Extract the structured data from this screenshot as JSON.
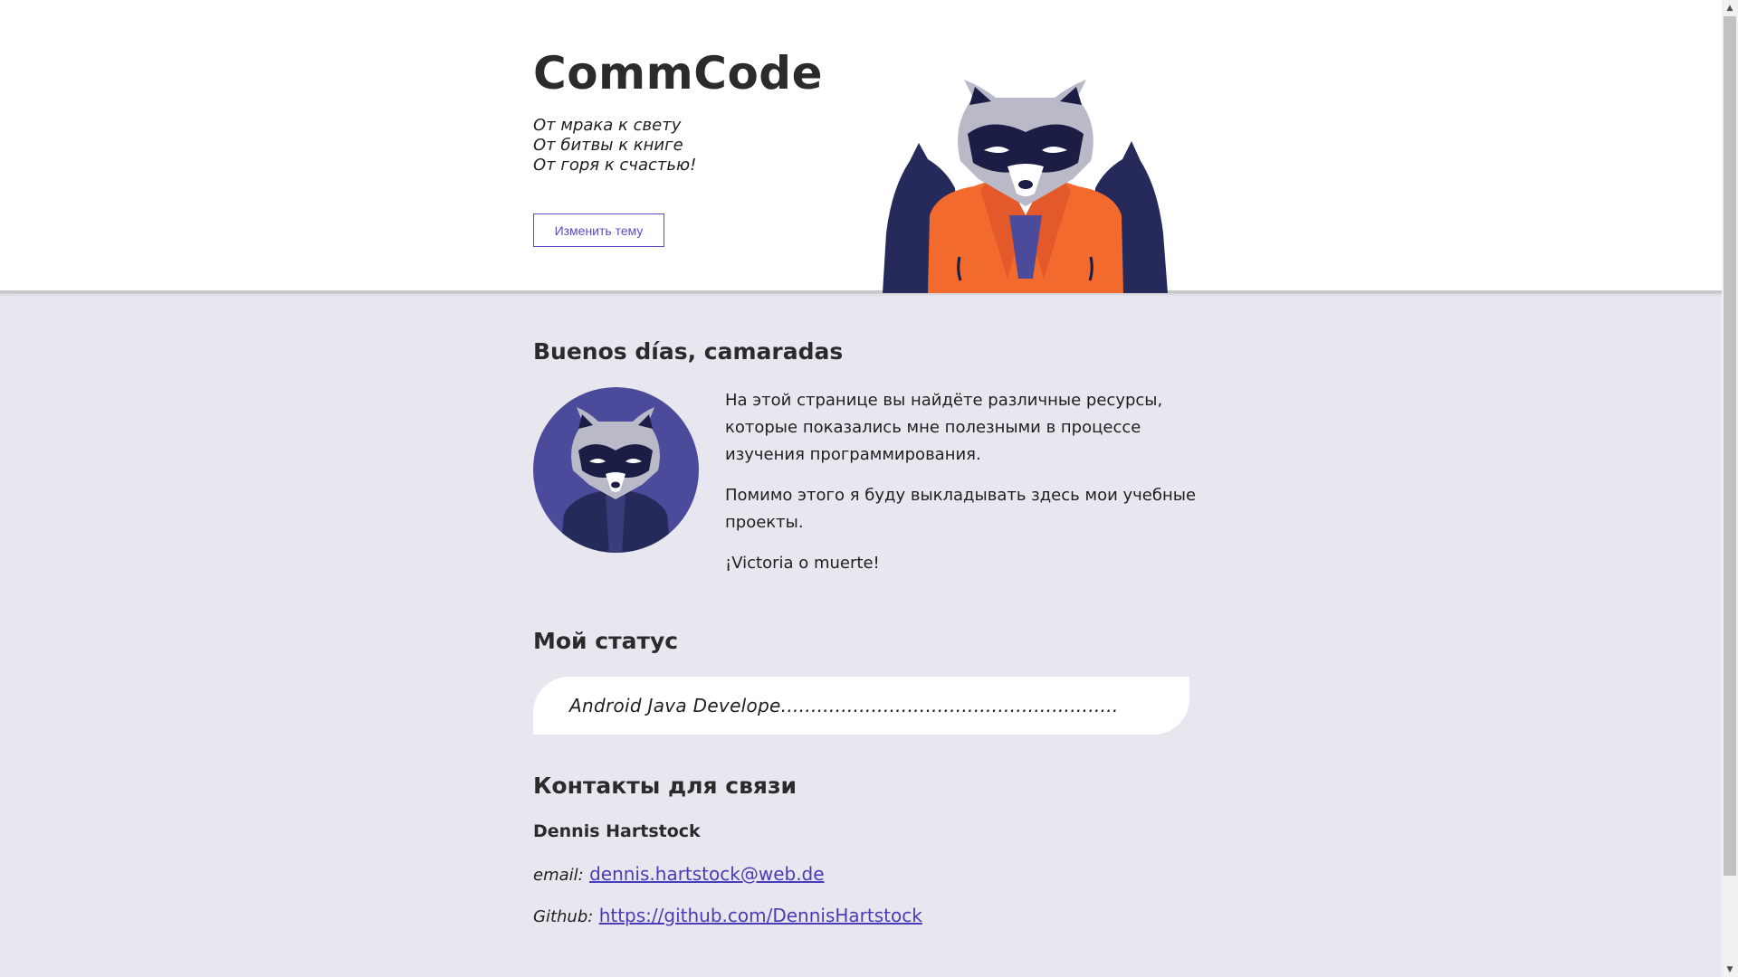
{
  "header": {
    "title": "CommCode",
    "motto": [
      "От мрака к свету",
      "От битвы к книге",
      "От горя к счастью!"
    ],
    "theme_button": "Изменить тему",
    "hero_image": "raccoon-in-orange-jacket-illustration"
  },
  "greeting": {
    "title": "Buenos días, camaradas",
    "avatar": "raccoon-avatar",
    "paragraphs": [
      "На этой странице вы найдёте различные ресурсы, которые показались мне полезными в процессе изучения программирования.",
      "Помимо этого я буду выкладывать здесь мои учебные проекты.",
      "¡Victoria o muerte!"
    ]
  },
  "status": {
    "title": "Мой статус",
    "text": "Android Java Develope........................................................"
  },
  "contacts": {
    "title": "Контакты для связи",
    "name": "Dennis Hartstock",
    "email_label": "email:",
    "email": "dennis.hartstock@web.de",
    "github_label": "Github:",
    "github": "https://github.com/DennisHartstock"
  },
  "colors": {
    "accent": "#5a4bc6",
    "link": "#4a3bb8",
    "background": "#e8e7ef",
    "jacket": "#f26a2e",
    "dark_navy": "#262a5b"
  }
}
